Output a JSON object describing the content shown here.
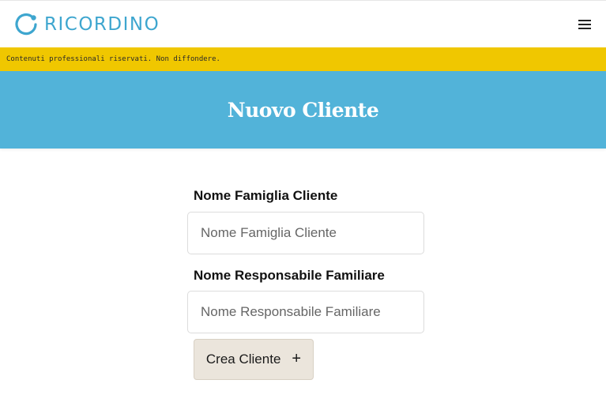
{
  "brand": {
    "name": "RICORDINO",
    "color": "#3ea6cf",
    "logo_icon": "ring-dot-icon"
  },
  "header": {
    "menu_icon": "hamburger-menu-icon"
  },
  "notice": {
    "text": "Contenuti professionali riservati. Non diffondere.",
    "background": "#f0c700"
  },
  "hero": {
    "title": "Nuovo Cliente",
    "background": "#52b3d9"
  },
  "form": {
    "family_name": {
      "label": "Nome Famiglia Cliente",
      "placeholder": "Nome Famiglia Cliente",
      "value": ""
    },
    "responsible_name": {
      "label": "Nome Responsabile Familiare",
      "placeholder": "Nome Responsabile Familiare",
      "value": ""
    },
    "submit": {
      "label": "Crea Cliente",
      "icon": "plus-icon",
      "icon_glyph": "+"
    }
  }
}
